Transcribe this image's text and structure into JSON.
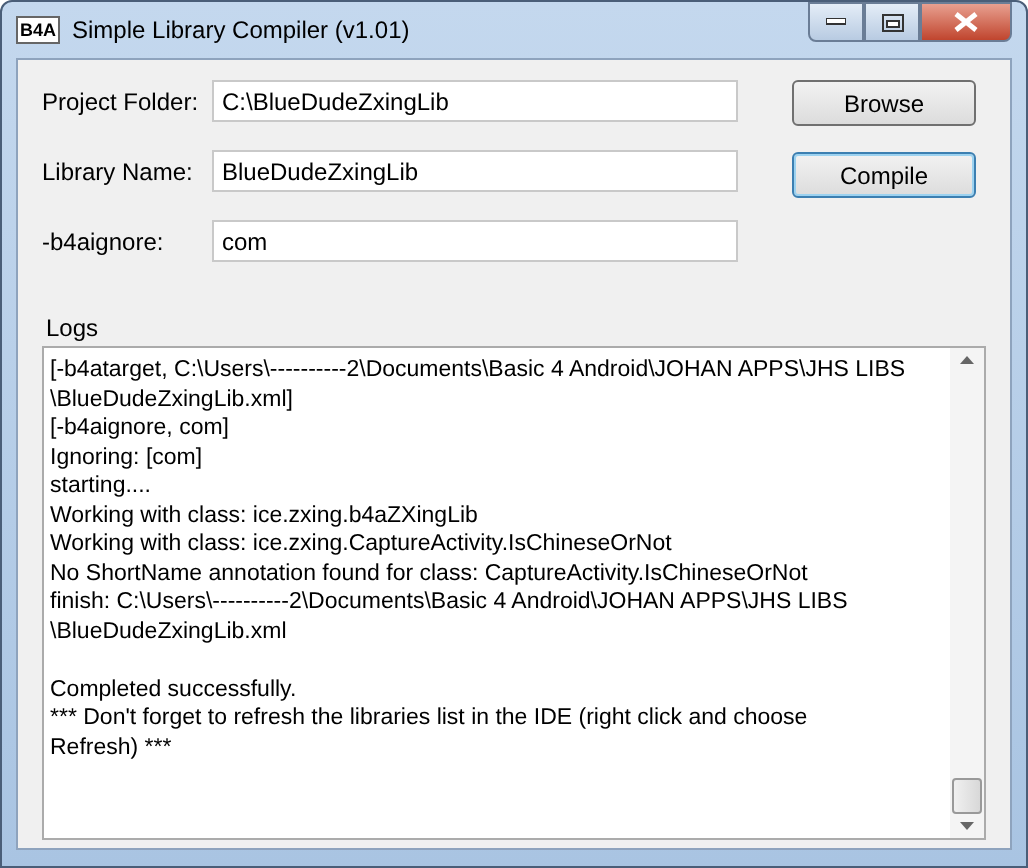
{
  "window": {
    "title": "Simple Library Compiler (v1.01)",
    "icon_text": "B4A"
  },
  "fields": [
    {
      "label": "Project Folder:",
      "value": "C:\\BlueDudeZxingLib"
    },
    {
      "label": "Library Name:",
      "value": "BlueDudeZxingLib"
    },
    {
      "label": "-b4aignore:",
      "value": "com"
    }
  ],
  "buttons": [
    {
      "label": "Browse",
      "focused": false
    },
    {
      "label": "Compile",
      "focused": true
    }
  ],
  "logs": {
    "label": "Logs",
    "paragraphs": [
      {
        "lines": [
          "[-b4atarget, C:\\Users\\----------2\\Documents\\Basic 4 Android\\JOHAN APPS\\JHS LIBS",
          "\\BlueDudeZxingLib.xml]",
          "[-b4aignore, com]",
          "Ignoring: [com]",
          "starting....",
          "Working with class: ice.zxing.b4aZXingLib",
          "Working with class: ice.zxing.CaptureActivity.IsChineseOrNot",
          "No ShortName annotation found for class: CaptureActivity.IsChineseOrNot",
          "finish: C:\\Users\\----------2\\Documents\\Basic 4 Android\\JOHAN APPS\\JHS LIBS",
          "\\BlueDudeZxingLib.xml"
        ]
      },
      {
        "lines": [
          "Completed successfully.",
          "*** Don't forget to refresh the libraries list in the IDE (right click and choose",
          "Refresh) ***"
        ]
      }
    ]
  }
}
